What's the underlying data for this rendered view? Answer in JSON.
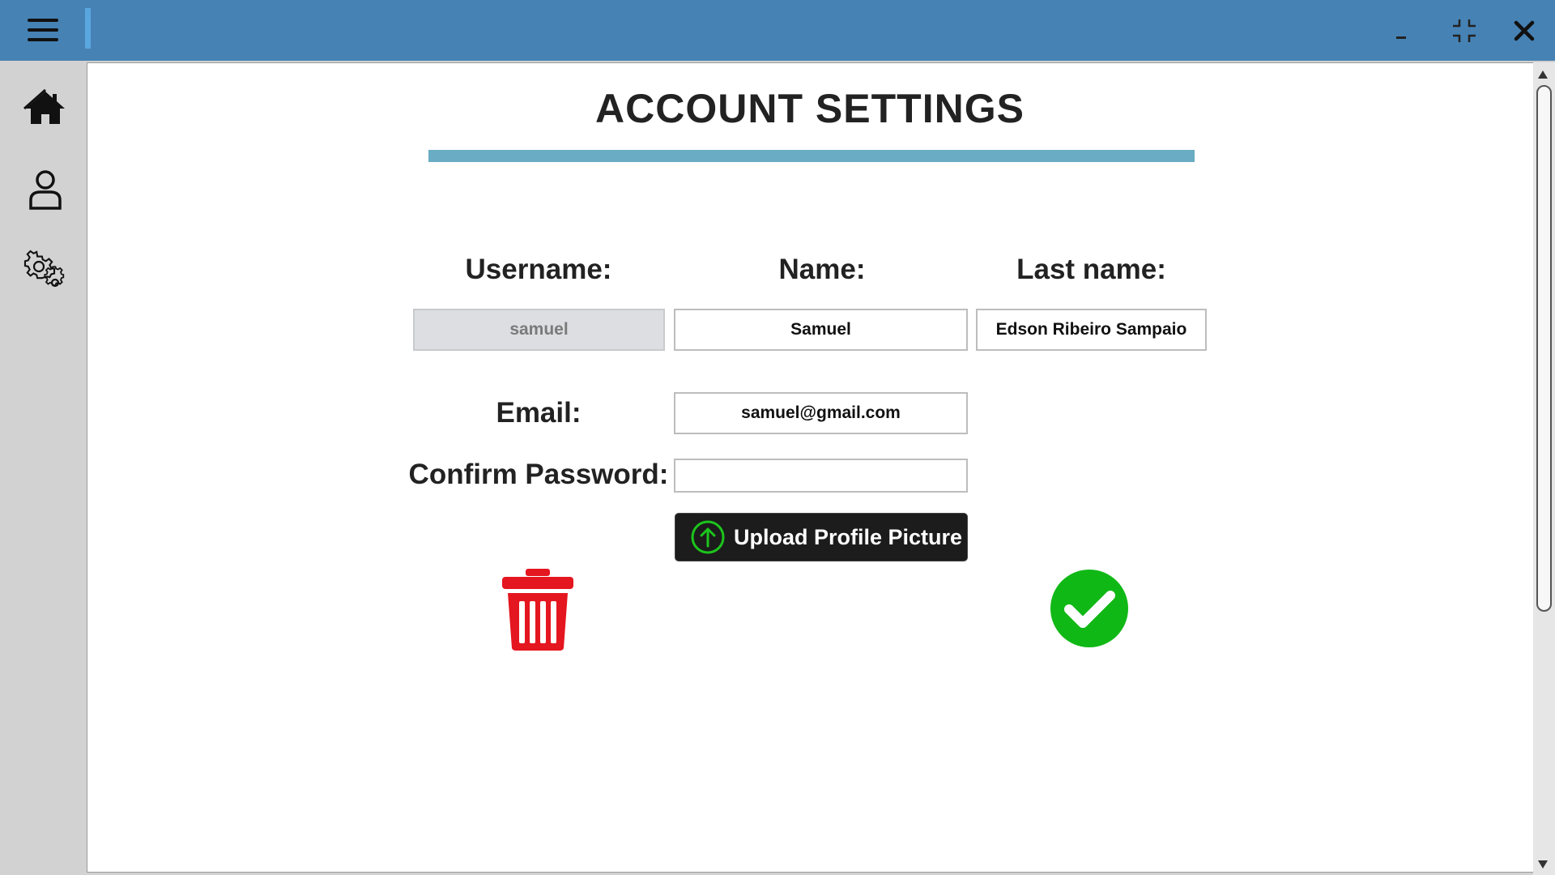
{
  "window": {
    "menu_icon": "hamburger-menu-icon",
    "minimize_icon": "minimize-icon",
    "restore_icon": "restore-icon",
    "close_icon": "close-icon"
  },
  "sidebar": {
    "items": [
      {
        "icon": "home-icon"
      },
      {
        "icon": "user-icon"
      },
      {
        "icon": "settings-gears-icon"
      }
    ]
  },
  "page": {
    "title": "ACCOUNT SETTINGS"
  },
  "form": {
    "username_label": "Username:",
    "username_value": "samuel",
    "name_label": "Name:",
    "name_value": "Samuel",
    "lastname_label": "Last name:",
    "lastname_value": "Edson Ribeiro Sampaio",
    "email_label": "Email:",
    "email_value": "samuel@gmail.com",
    "confirm_password_label": "Confirm Password:",
    "confirm_password_value": "",
    "upload_label": "Upload Profile Picture"
  },
  "actions": {
    "delete_icon": "trash-icon",
    "confirm_icon": "checkmark-icon"
  },
  "colors": {
    "titlebar": "#4682b4",
    "title_rule": "#6aacc3",
    "delete": "#e4161f",
    "confirm": "#10b816",
    "upload_bg": "#1c1c1c"
  }
}
